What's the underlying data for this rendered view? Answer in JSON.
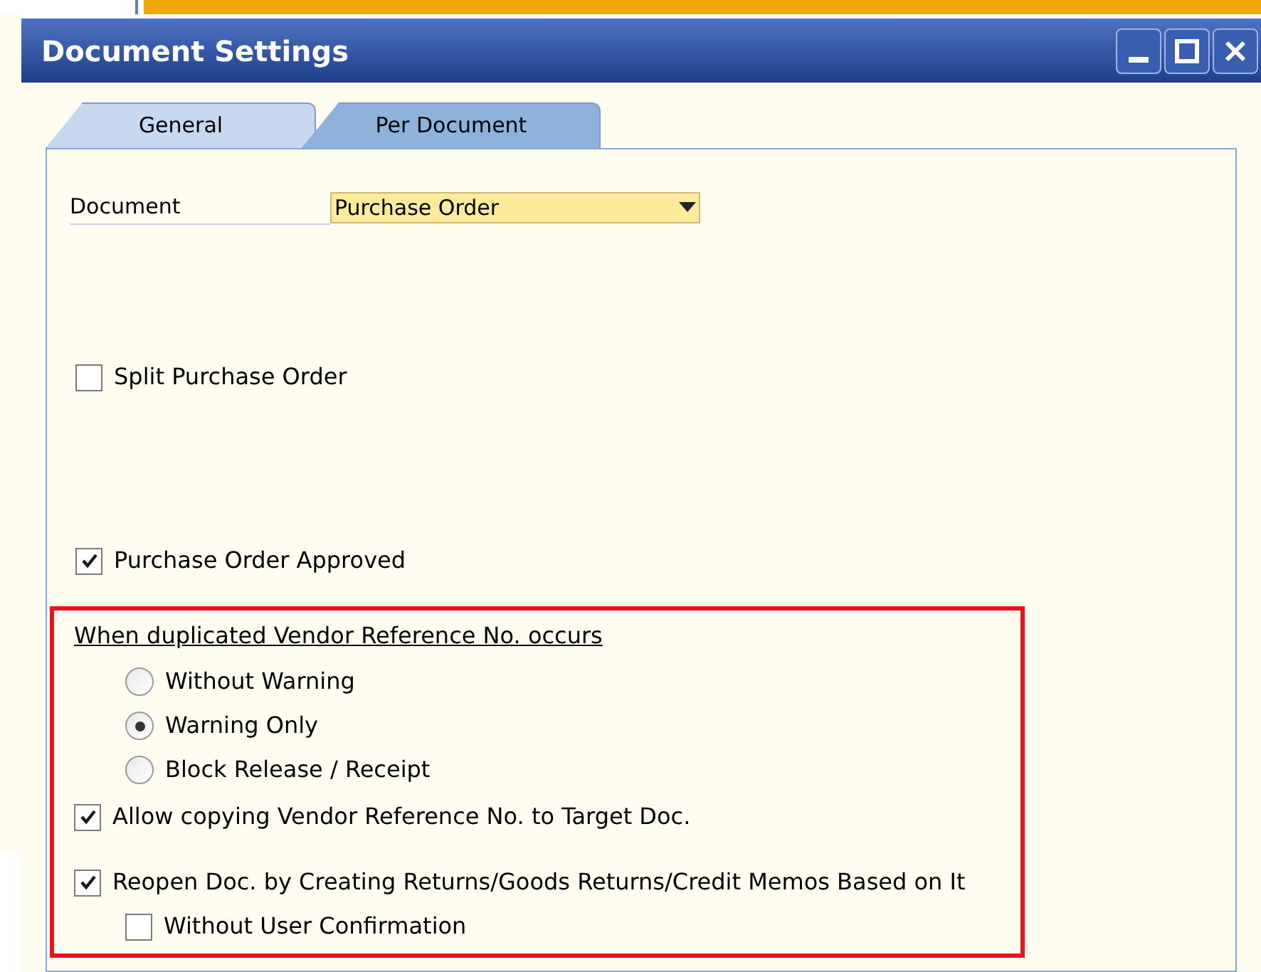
{
  "window": {
    "title": "Document Settings"
  },
  "tabs": [
    {
      "label": "General",
      "selected": false
    },
    {
      "label": "Per Document",
      "selected": true
    }
  ],
  "document": {
    "label": "Document",
    "value": "Purchase Order"
  },
  "split_purchase_order": {
    "label": "Split Purchase Order",
    "checked": false
  },
  "purchase_order_approved": {
    "label": "Purchase Order Approved",
    "checked": true
  },
  "duplicate_reference": {
    "heading": "When duplicated Vendor Reference No. occurs",
    "options": [
      {
        "label": "Without Warning",
        "selected": false
      },
      {
        "label": "Warning Only",
        "selected": true
      },
      {
        "label": "Block Release / Receipt",
        "selected": false
      }
    ]
  },
  "allow_copying": {
    "label": "Allow copying Vendor Reference No. to Target Doc.",
    "checked": true
  },
  "reopen_doc": {
    "label": "Reopen Doc. by Creating Returns/Goods Returns/Credit Memos Based on It",
    "checked": true
  },
  "without_user_confirmation": {
    "label": "Without User Confirmation",
    "checked": false
  }
}
